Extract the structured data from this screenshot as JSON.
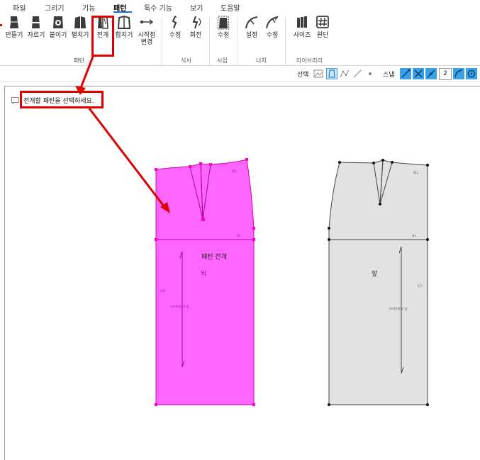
{
  "menu": {
    "items": [
      {
        "label": "파일"
      },
      {
        "label": "그리기"
      },
      {
        "label": "기능"
      },
      {
        "label": "패턴"
      },
      {
        "label": "특수 기능"
      },
      {
        "label": "보기"
      },
      {
        "label": "도움말"
      }
    ],
    "active": "패턴"
  },
  "ribbon": {
    "tools": {
      "make": "만들기",
      "cut": "자르기",
      "attach": "붙이기",
      "unfold": "펼치기",
      "expand": "전개",
      "merge": "합치기",
      "start_point_line1": "시작점",
      "start_point_line2": "변경",
      "edit_seam": "수정",
      "rotate": "회전",
      "edit_grain": "수정",
      "notch_set": "설정",
      "notch_edit": "수정",
      "size": "사이즈",
      "fabric": "원단"
    },
    "groups": {
      "pattern": "패턴",
      "seam": "식서",
      "grain": "시접",
      "notch": "너치",
      "library": "라이브러리"
    }
  },
  "toolbar2": {
    "select_label": "선택",
    "snap_label": "스냅",
    "snap_value": "2"
  },
  "prompt": {
    "text": "전개할 패턴을 선택하세요."
  },
  "pattern_back": {
    "title": "패턴 전개",
    "name": "뒤",
    "waist_label": "W.L",
    "hip_label": "H.L",
    "cb_label": "C.B",
    "grain_text": "스커트(밑단) 뒤"
  },
  "pattern_front": {
    "name": "앞",
    "waist_label": "W.L",
    "hip_label": "H.L",
    "cf_label": "C.F",
    "grain_text": "스커트(밑단) 앞"
  },
  "colors": {
    "highlight_fill": "#ff66ff",
    "highlight_vertex": "#ff00cc",
    "pattern_fill": "#e2e2e2",
    "annotation_red": "#e00000",
    "accent_blue": "#3ba0e6"
  }
}
